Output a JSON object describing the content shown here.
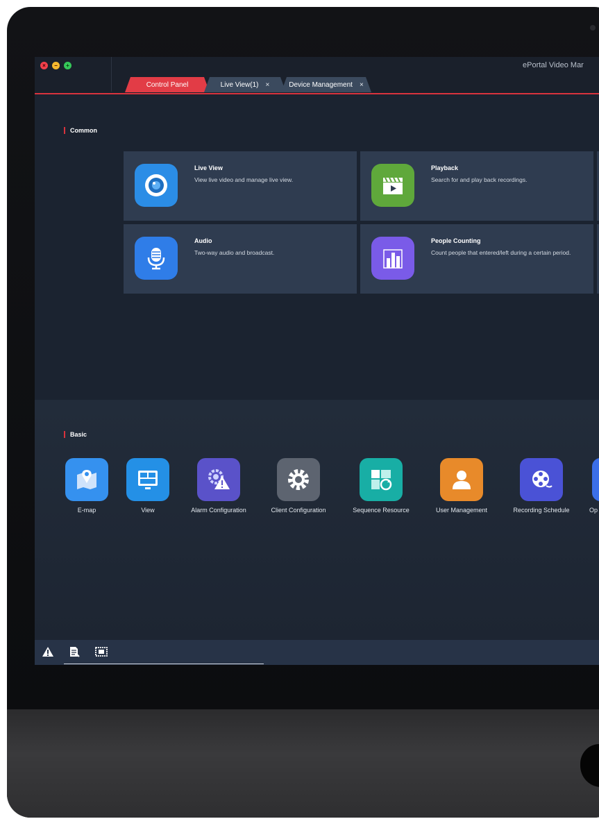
{
  "window": {
    "title": "ePortal Video Mar",
    "traffic": {
      "close": "×",
      "minimize": "−",
      "maximize": "+"
    }
  },
  "tabs": [
    {
      "label": "Control Panel",
      "active": true
    },
    {
      "label": "Live View(1)",
      "close": "×"
    },
    {
      "label": "Device Management",
      "close": "×"
    }
  ],
  "common": {
    "title": "Common",
    "cards": [
      {
        "title": "Live View",
        "desc": "View live video and manage live view.",
        "icon": "camera-icon",
        "color": "#2b8de6"
      },
      {
        "title": "Playback",
        "desc": "Search for and play back recordings.",
        "icon": "clapperboard-icon",
        "color": "#5fa83b"
      },
      {
        "title": "Audio",
        "desc": "Two-way audio and broadcast.",
        "icon": "microphone-icon",
        "color": "#2f7de8"
      },
      {
        "title": "People Counting",
        "desc": "Count people that entered/left during a certain period.",
        "icon": "bar-chart-icon",
        "color": "#7a5be8"
      }
    ]
  },
  "basic": {
    "title": "Basic",
    "items": [
      {
        "label": "E-map",
        "icon": "map-icon",
        "color": "#3591ef"
      },
      {
        "label": "View",
        "icon": "monitor-layout-icon",
        "color": "#2490e6"
      },
      {
        "label": "Alarm Configuration",
        "icon": "alarm-gear-icon",
        "color": "#5a52c9"
      },
      {
        "label": "Client Configuration",
        "icon": "gear-icon",
        "color": "#5d6470"
      },
      {
        "label": "Sequence Resource",
        "icon": "sequence-icon",
        "color": "#18aea5"
      },
      {
        "label": "User Management",
        "icon": "user-icon",
        "color": "#e88a2a"
      },
      {
        "label": "Recording Schedule",
        "icon": "film-reel-icon",
        "color": "#4a52d6"
      },
      {
        "label": "Op",
        "icon": "operation-icon",
        "color": "#3b6fe8"
      }
    ]
  },
  "statusbar": {
    "icons": [
      "warning-icon",
      "log-icon",
      "screen-icon"
    ]
  }
}
